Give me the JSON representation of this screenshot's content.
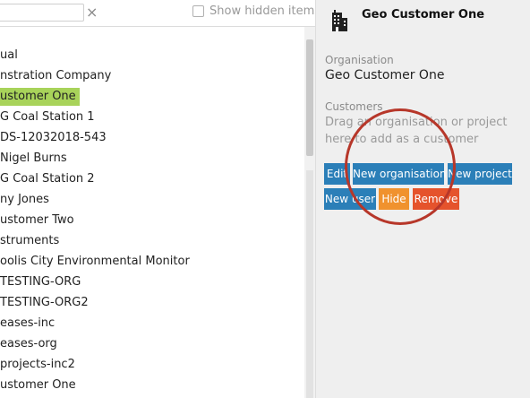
{
  "toolbar": {
    "search_value": "",
    "clear_glyph": "×",
    "show_hidden_label": "Show hidden items"
  },
  "tree": {
    "items": [
      {
        "label": "ual",
        "selected": false
      },
      {
        "label": "nstration Company",
        "selected": false
      },
      {
        "label": "ustomer One",
        "selected": true
      },
      {
        "label": "G Coal Station 1",
        "selected": false
      },
      {
        "label": "DS-12032018-543",
        "selected": false
      },
      {
        "label": "Nigel Burns",
        "selected": false
      },
      {
        "label": "G Coal Station 2",
        "selected": false
      },
      {
        "label": "ny Jones",
        "selected": false
      },
      {
        "label": "ustomer Two",
        "selected": false
      },
      {
        "label": "struments",
        "selected": false
      },
      {
        "label": "oolis City Environmental Monitoring",
        "selected": false
      },
      {
        "label": "TESTING-ORG",
        "selected": false
      },
      {
        "label": "TESTING-ORG2",
        "selected": false
      },
      {
        "label": "eases-inc",
        "selected": false
      },
      {
        "label": "eases-org",
        "selected": false
      },
      {
        "label": "projects-inc2",
        "selected": false
      },
      {
        "label": "ustomer One",
        "selected": false
      }
    ]
  },
  "details": {
    "title": "Geo Customer One",
    "icon": "building-icon",
    "organisation_label": "Organisation",
    "organisation_value": "Geo Customer One",
    "customers_label": "Customers",
    "customers_hint": "Drag an organisation or project here to add as a customer"
  },
  "buttons": {
    "edit": "Edit",
    "new_organisation": "New organisation",
    "new_project": "New project",
    "new_user": "New user",
    "hide": "Hide",
    "remove": "Remove"
  },
  "colors": {
    "selected_highlight": "#a8d35a",
    "button_blue": "#2b7fb8",
    "button_orange": "#f0922e",
    "button_red": "#e5532c",
    "annotation": "#b7372a"
  }
}
